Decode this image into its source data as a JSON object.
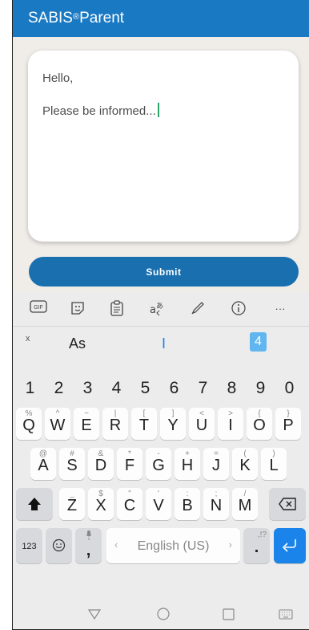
{
  "app": {
    "title": "SABIS",
    "title_mark": "®",
    "title_suffix": " Parent",
    "message_line1": "Hello,",
    "message_line2": "Please be informed...",
    "submit_label": "Submit"
  },
  "keyboard": {
    "toolbar": {
      "gif": "GIF",
      "more": "···"
    },
    "suggestions": {
      "close": "ˣ",
      "first": "As",
      "second": "I",
      "third": "4"
    },
    "numbers": [
      "1",
      "2",
      "3",
      "4",
      "5",
      "6",
      "7",
      "8",
      "9",
      "0"
    ],
    "row_q": {
      "letters": [
        "Q",
        "W",
        "E",
        "R",
        "T",
        "Y",
        "U",
        "I",
        "O",
        "P"
      ],
      "hints": [
        "%",
        "^",
        "~",
        "|",
        "[",
        "]",
        "<",
        ">",
        "{",
        "}"
      ]
    },
    "row_a": {
      "letters": [
        "A",
        "S",
        "D",
        "F",
        "G",
        "H",
        "J",
        "K",
        "L"
      ],
      "hints": [
        "@",
        "#",
        "&",
        "*",
        "-",
        "+",
        "=",
        "(",
        ")"
      ]
    },
    "row_z": {
      "letters": [
        "Z",
        "X",
        "C",
        "V",
        "B",
        "N",
        "M"
      ],
      "hints": [
        "_",
        "$",
        "\"",
        "'",
        ":",
        ";",
        "/"
      ]
    },
    "bottom": {
      "num_label": "123",
      "comma": ",",
      "space_label": "English (US)",
      "period": ".",
      "period_hint": ",!?"
    }
  },
  "colors": {
    "brand": "#1a79c3",
    "button": "#1a6faf",
    "enter": "#1a84ea"
  }
}
